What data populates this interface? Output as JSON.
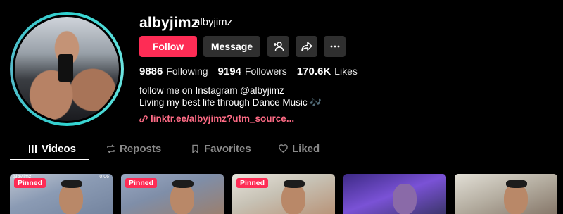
{
  "profile": {
    "username": "albyjimz",
    "nickname": "albyjimz"
  },
  "actions": {
    "follow_label": "Follow",
    "message_label": "Message",
    "add_user_icon": "add-user-icon",
    "share_icon": "share-icon",
    "more_icon": "more-dots-icon"
  },
  "stats": {
    "following_count": "9886",
    "following_label": "Following",
    "followers_count": "9194",
    "followers_label": "Followers",
    "likes_count": "170.6K",
    "likes_label": "Likes"
  },
  "bio": {
    "line1": "follow me on Instagram @albyjimz",
    "line2": "Living my best life through Dance Music 🎶"
  },
  "link": {
    "text": "linktr.ee/albyjimz?utm_source..."
  },
  "tabs": [
    {
      "label": "Videos",
      "icon": "grid-icon",
      "active": true
    },
    {
      "label": "Reposts",
      "icon": "repost-icon",
      "active": false
    },
    {
      "label": "Favorites",
      "icon": "bookmark-icon",
      "active": false
    },
    {
      "label": "Liked",
      "icon": "heart-icon",
      "active": false
    }
  ],
  "videos": [
    {
      "pinned": "Pinned",
      "tag": "albyjimz",
      "time": "0:06"
    },
    {
      "pinned": "Pinned"
    },
    {
      "pinned": "Pinned"
    },
    {},
    {}
  ],
  "colors": {
    "accent": "#fe2c55",
    "link": "#fe6b85",
    "avatar_ring": "#2fd3d0"
  }
}
